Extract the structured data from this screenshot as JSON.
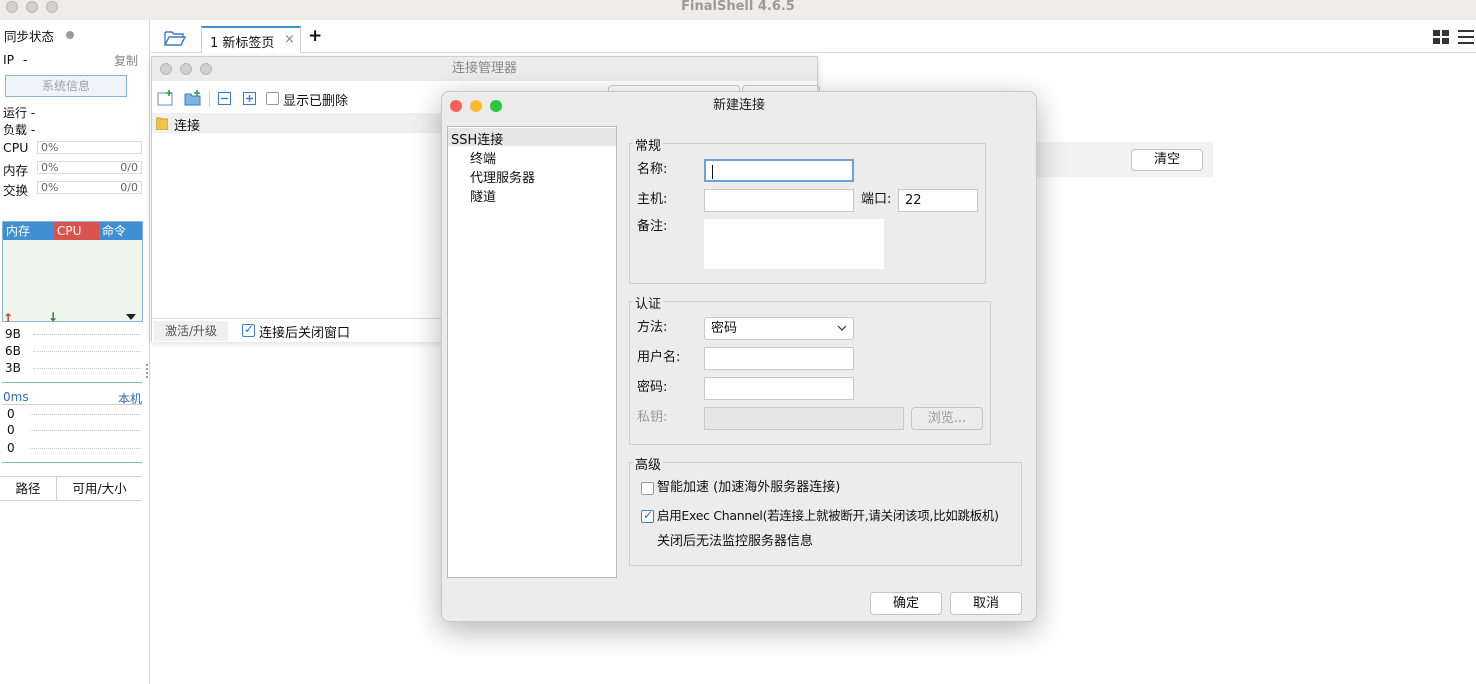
{
  "app": {
    "title": "FinalShell 4.6.5"
  },
  "left_panel": {
    "sync_status": "同步状态",
    "ip_label": "IP",
    "ip_value": "-",
    "copy": "复制",
    "sysinfo": "系统信息",
    "run": "运行 -",
    "load": "负载 -",
    "cpu_label": "CPU",
    "cpu_value": "0%",
    "mem_label": "内存",
    "mem_value": "0%",
    "mem_ratio": "0/0",
    "swap_label": "交换",
    "swap_value": "0%",
    "swap_ratio": "0/0",
    "proc_headers": [
      "内存",
      "CPU",
      "命令"
    ],
    "net_ticks": [
      "9B",
      "6B",
      "3B"
    ],
    "ping_value": "0ms",
    "ping_target": "本机",
    "ping_ticks": [
      "0",
      "0",
      "0"
    ],
    "disk_headers": [
      "路径",
      "可用/大小"
    ]
  },
  "tabs": [
    {
      "label": "1 新标签页"
    }
  ],
  "tab_close": "×",
  "tab_add": "+",
  "clear_button": "清空",
  "conn_manager": {
    "title": "连接管理器",
    "show_deleted": "显示已删除",
    "folder": "连接",
    "activate": "激活/升级",
    "close_after": "连接后关闭窗口"
  },
  "dialog": {
    "title": "新建连接",
    "tree": [
      "SSH连接",
      "终端",
      "代理服务器",
      "隧道"
    ],
    "general": {
      "group": "常规",
      "name_label": "名称:",
      "name_value": "",
      "host_label": "主机:",
      "host_value": "",
      "port_label": "端口:",
      "port_value": "22",
      "note_label": "备注:"
    },
    "auth": {
      "group": "认证",
      "method_label": "方法:",
      "method_value": "密码",
      "user_label": "用户名:",
      "password_label": "密码:",
      "key_label": "私钥:",
      "browse": "浏览..."
    },
    "advanced": {
      "group": "高级",
      "smart_accel": "智能加速 (加速海外服务器连接)",
      "exec_channel": "启用Exec Channel(若连接上就被断开,请关闭该项,比如跳板机)",
      "exec_note": "关闭后无法监控服务器信息"
    },
    "ok": "确定",
    "cancel": "取消"
  },
  "colors": {
    "proc_mem": "#3f8fd2",
    "proc_cpu": "#d9534f",
    "proc_cmd": "#3f8fd2",
    "upload_arrow": "#c0392b",
    "download_arrow": "#2e7d32",
    "close_dot": "#fe5f57",
    "min_dot": "#febc2e",
    "max_dot": "#28c840"
  }
}
